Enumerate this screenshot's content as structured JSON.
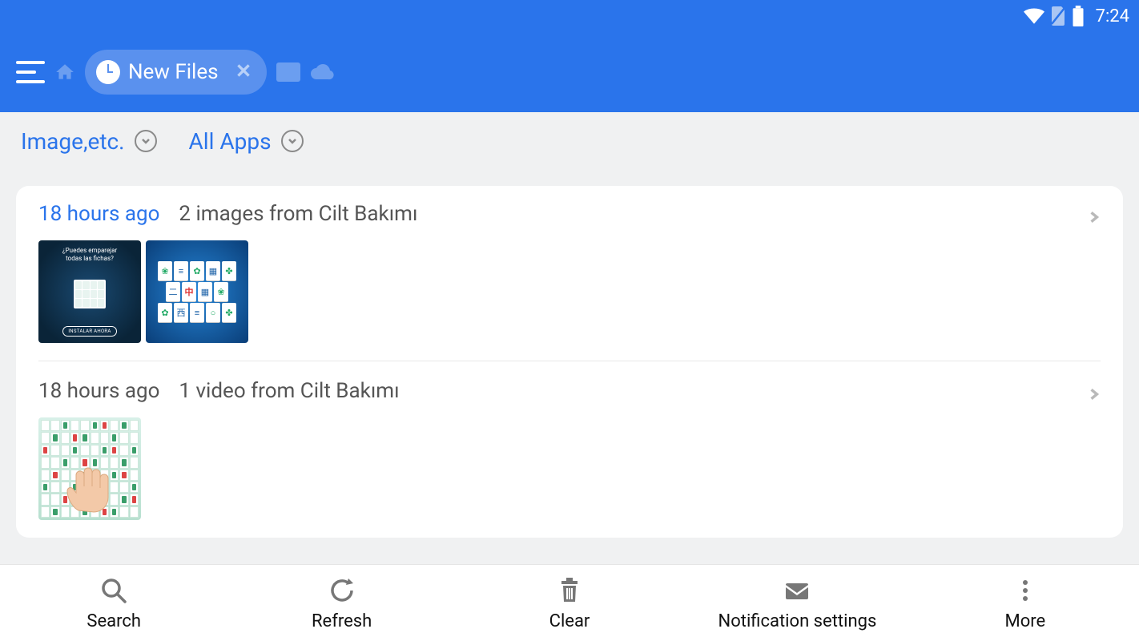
{
  "status": {
    "time": "7:24"
  },
  "header": {
    "tab_label": "New Files"
  },
  "filters": {
    "type_label": "Image,etc.",
    "apps_label": "All Apps"
  },
  "groups": [
    {
      "time": "18 hours ago",
      "desc": "2 images from Cilt Bakımı",
      "promo_line1": "¿Puedes emparejar",
      "promo_line2": "todas las fichas?",
      "promo_btn": "INSTALAR AHORA"
    },
    {
      "time": "18 hours ago",
      "desc": "1 video from Cilt Bakımı"
    }
  ],
  "bottom": {
    "search": "Search",
    "refresh": "Refresh",
    "clear": "Clear",
    "notif": "Notification settings",
    "more": "More"
  }
}
